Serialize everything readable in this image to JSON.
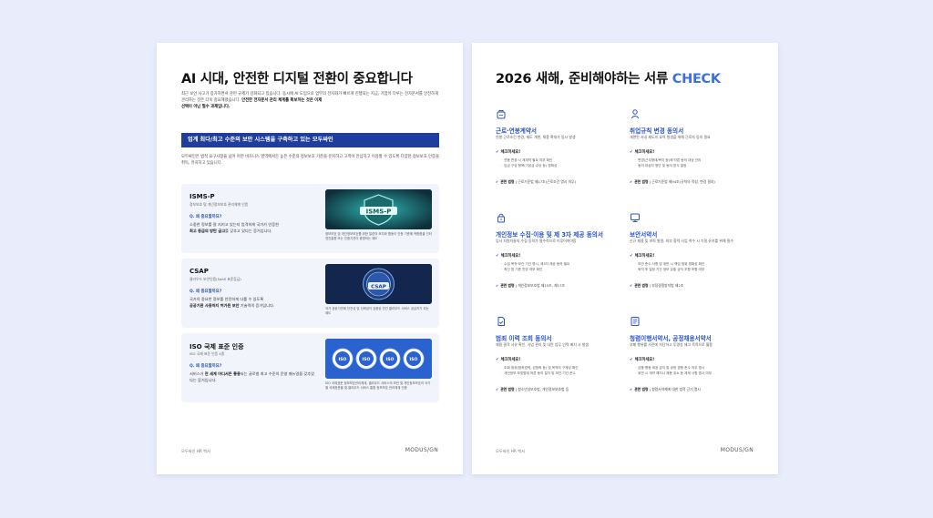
{
  "left_page": {
    "title": "AI 시대, 안전한 디지털 전환이 중요합니다",
    "intro_line1": "최근 보안 사고가 증가하면서 관련 규제가 강화되고 있습니다. 동시에 AI 도입으로 업무의 전자화가 빠르게 진행되는 지금,",
    "intro_line2": "기업이 다루는 전자문서를 안전하게 관리하는 것은 더욱 중요해졌습니다.",
    "intro_bold": "안전한 전자문서 관리 체계를 확보하는 것은 이제",
    "intro_bold2": "선택이 아닌 필수 과제입니다.",
    "banner": "업계 최다/최고 수준의 보안 시스템을 구축하고 있는 모두싸인",
    "banner_desc": "모두싸인은 법적 요구사항을 넘어 어떤 비즈니스 영역에서든 높은 수준의 정보보호 기준을 유지하고 고객이 안심하고 이용할 수 있도록 다양한 정보보호 인증을 취득, 유지하고 있습니다.",
    "certs": [
      {
        "name": "ISMS-P",
        "sub": "정보보호 및 개인정보보호 관리체계 인증",
        "q": "Q. 왜 중요할까요?",
        "a_pre": "소중한 정보를 잘 지키고 있는지 엄격하게 국가가 인증한",
        "a_bold": "최고 등급의 방탄 금고",
        "a_post": "를 갖추고 있다는 증거입니다.",
        "badge_text": "ISMS-P",
        "caption": "정보보호 및 개인정보보호를 위한 일련의 조치와 활동이 인증 기준에 적합함을 인터넷진흥원 또는 인증기관이 증명하는 제도"
      },
      {
        "name": "CSAP",
        "sub": "클라우드 보안인증(SaaS 표준등급)",
        "q": "Q. 왜 중요할까요?",
        "a_pre": "국가의 중요한 정보를 안전하게 다룰 수 있도록",
        "a_bold": "공공기관 사용까지 허가된 보안",
        "a_post": " 기술력의 증거입니다.",
        "badge_text": "CSAP",
        "caption": "국가 공공기관에 안전성 및 신뢰성이 검증된 민간 클라우드 서비스 공급자가 되는 제도"
      },
      {
        "name": "ISO 국제 표준 인증",
        "sub": "ISO 국제 표준 인증 4종",
        "q": "Q. 왜 중요할까요?",
        "a_pre": "서비스가 ",
        "a_bold": "전 세계 어디서든 통용",
        "a_post": "되는 글로벌 최고 수준의 운영 매뉴얼을 갖추었다는 증거입니다.",
        "badge_text": "ISO",
        "caption": "ISO 국제표준 정보보호관리체계, 클라우드 서비스의 보안 및 개인정보보호의 국가별 국제표준을 및 클라우드 서비스 통합 정보보호 관리체계 인증"
      }
    ],
    "footer_left": "모두싸인 HR 백서",
    "footer_right": "MODUS/GN"
  },
  "right_page": {
    "title_prefix": "2026 새해, 준비해야하는 서류 ",
    "title_accent": "CHECK",
    "check_label": "체크하세요!",
    "law_label": "관련 법령",
    "documents": [
      {
        "icon": "contract-bag-icon",
        "title": "근로·연봉계약서",
        "desc": "연봉·근로조건 변경, 제도 개편, 채용 확대가 동시 발생",
        "bullets": [
          "연봉 변경 시 재계약 필요 여부 확인",
          "임금 구성 항목(기본급·수당 등) 명확성"
        ],
        "law": "근로기준법 제17조(근로조건 명시 의무)"
      },
      {
        "icon": "person-icon",
        "title": "취업규칙 변경 동의서",
        "desc": "개편된 사내 제도의 효력 발생을 위해 근로자 동의 필요",
        "bullets": [
          "변경(근무형태/복지 등)에 따른 동의 대상 관리",
          "동의 대상자 명단 및 동의 방식 결정"
        ],
        "law": "근로기준법 제94조(규칙의 작성, 변경 절차)"
      },
      {
        "icon": "lock-icon",
        "title": "개인정보 수집·이용 및 제 3자 제공 동의서",
        "desc": "입사 지원자들의 수집 동의가 필수적으로 이루어져야함",
        "bullets": [
          "수집 목적·보관 기간 명시, 제3자 제공 동의 필요",
          "최신 법 기준 반영 여부 확인"
        ],
        "law": "개인정보보호법 제15조, 제17조"
      },
      {
        "icon": "monitor-icon",
        "title": "보안서약서",
        "desc": "신규 채용 및 보직 발령, 외부 협력 사업 착수 시 기밀 유지를 위해 필수",
        "bullets": [
          "보안 준수 사항 및 위반 시 책임 범위 명확성 확인",
          "퇴직 후 일정 기간 정보 유출 금지 조항 포함 여부"
        ],
        "law": "부정경쟁방지법 제2조"
      },
      {
        "icon": "document-check-icon",
        "title": "범죄 이력 조회 동의서",
        "desc": "채용 결격 사유 확인, 사업 관리 및 내란 업무 인력 배치 시 발생",
        "bullets": [
          "조회 범위(범죄경력, 성범죄 등) 및 목적의 구체성 확인",
          "개인정보 보호법에 따른 동의 절차 및 보관 기간 준수"
        ],
        "law": "청소년성보호법, 개인정보보호법 등"
      },
      {
        "icon": "form-list-icon",
        "title": "청렴이행서약서, 공정채용서약서",
        "desc": "부패 행위를 사전에 차단하고 투명성 제고 목적으로 활용",
        "bullets": [
          "금품·향응 제공 금지 및 공정 경쟁 준수 의무 명시",
          "위반 시 계약 해지나 채용 취소 등 제재 사항 명시 여부"
        ],
        "law": "청렴서약제에 대한 법적 근거 명시"
      }
    ],
    "footer_left": "모두싸인 HR 백서",
    "footer_right": "MODUS/GN"
  }
}
